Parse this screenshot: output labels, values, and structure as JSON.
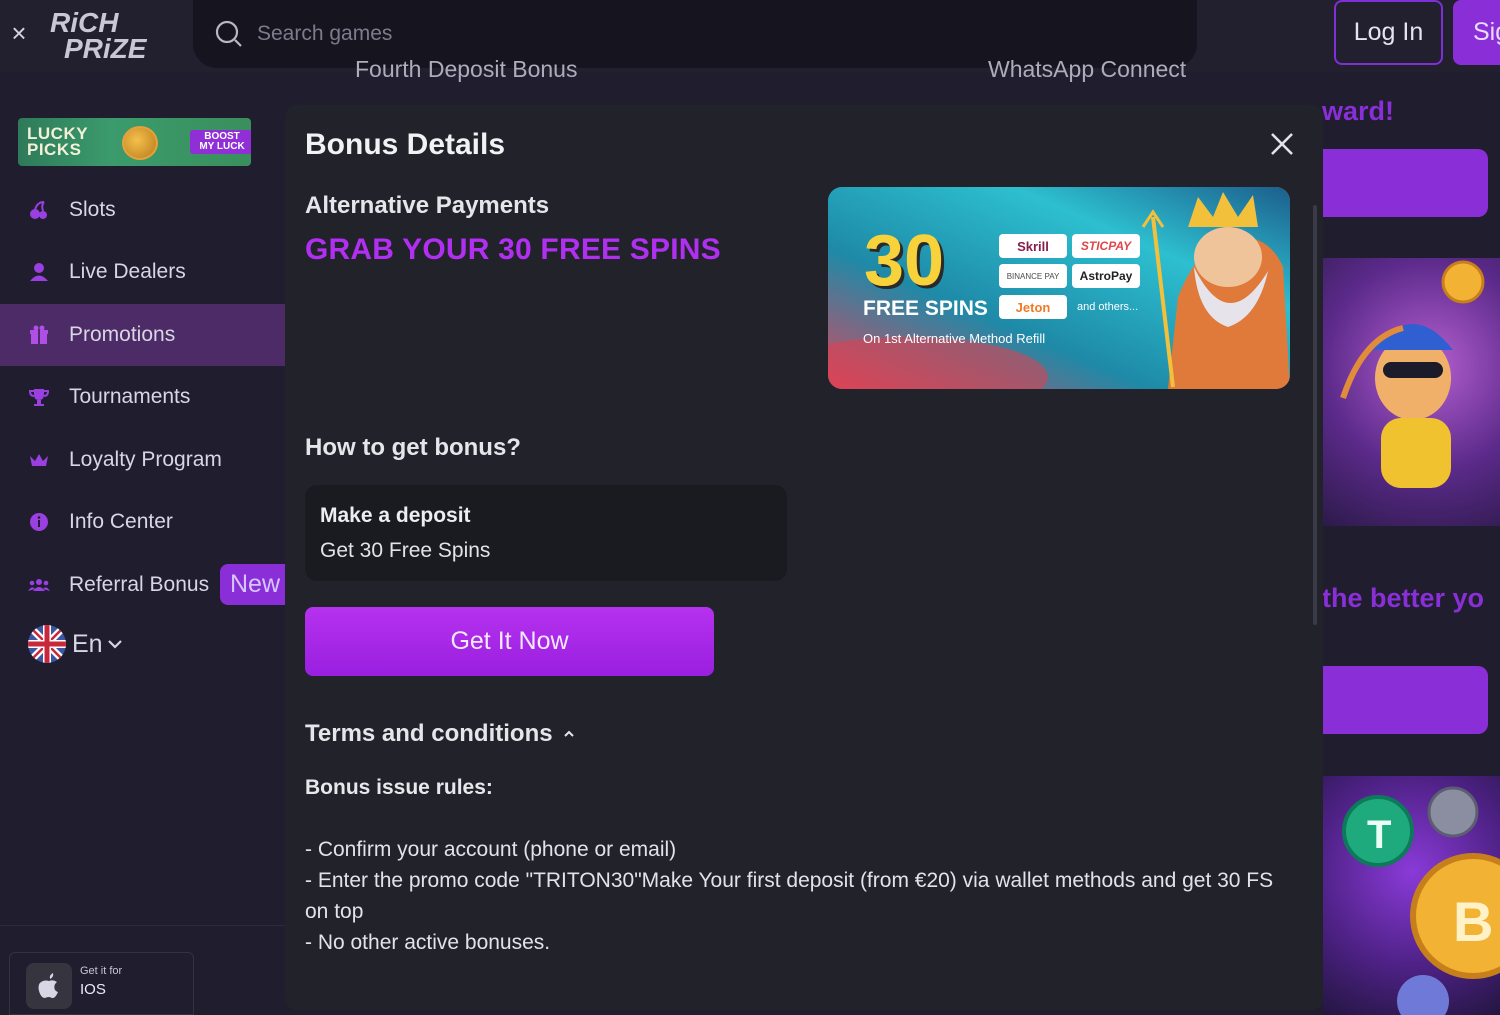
{
  "header": {
    "close_icon": "close-icon",
    "logo_line1": "RiCH",
    "logo_line2": "PRiZE",
    "search_placeholder": "Search games",
    "login_label": "Log In",
    "signup_label": "Sig"
  },
  "sidebar": {
    "promo_banner": {
      "line1": "LUCKY",
      "line2": "PICKS",
      "badge_line1": "BOOST",
      "badge_line2": "MY LUCK"
    },
    "items": [
      {
        "label": "Slots",
        "icon": "cherries-icon"
      },
      {
        "label": "Live Dealers",
        "icon": "dealer-icon"
      },
      {
        "label": "Promotions",
        "icon": "gift-icon",
        "active": true
      },
      {
        "label": "Tournaments",
        "icon": "trophy-icon"
      },
      {
        "label": "Loyalty Program",
        "icon": "crown-icon"
      },
      {
        "label": "Info Center",
        "icon": "info-icon"
      },
      {
        "label": "Referral Bonus",
        "icon": "users-icon"
      }
    ],
    "new_badge": "New",
    "language": "En",
    "app_download": {
      "small": "Get it for",
      "platform": "IOS"
    }
  },
  "background": {
    "card1_heading": "Fourth Deposit Bonus",
    "card2_heading": "WhatsApp Connect",
    "reward_text": "ward!",
    "better_text": "the better yo"
  },
  "modal": {
    "title": "Bonus Details",
    "subtitle": "Alternative Payments",
    "headline": "GRAB YOUR 30 FREE SPINS",
    "banner": {
      "number": "30",
      "free_spins": "FREE SPINS",
      "caption": "On 1st Alternative Method Refill",
      "methods": [
        "Skrill",
        "STICPAY",
        "BINANCE PAY",
        "AstroPay",
        "Jeton"
      ],
      "others": "and others..."
    },
    "how_title": "How to get bonus?",
    "step": {
      "title": "Make a deposit",
      "desc": "Get 30 Free Spins"
    },
    "cta_label": "Get It Now",
    "terms_label": "Terms and conditions",
    "rules_title": "Bonus issue rules:",
    "rules": [
      "- Confirm your account (phone or email)",
      "- Enter the promo code \"TRITON30\"Make Your first deposit (from €20) via wallet methods and get 30 FS on top",
      "- No other active bonuses."
    ]
  },
  "colors": {
    "accent": "#8a2fd8",
    "headline": "#b02ff0",
    "modal_bg": "#22222b"
  }
}
